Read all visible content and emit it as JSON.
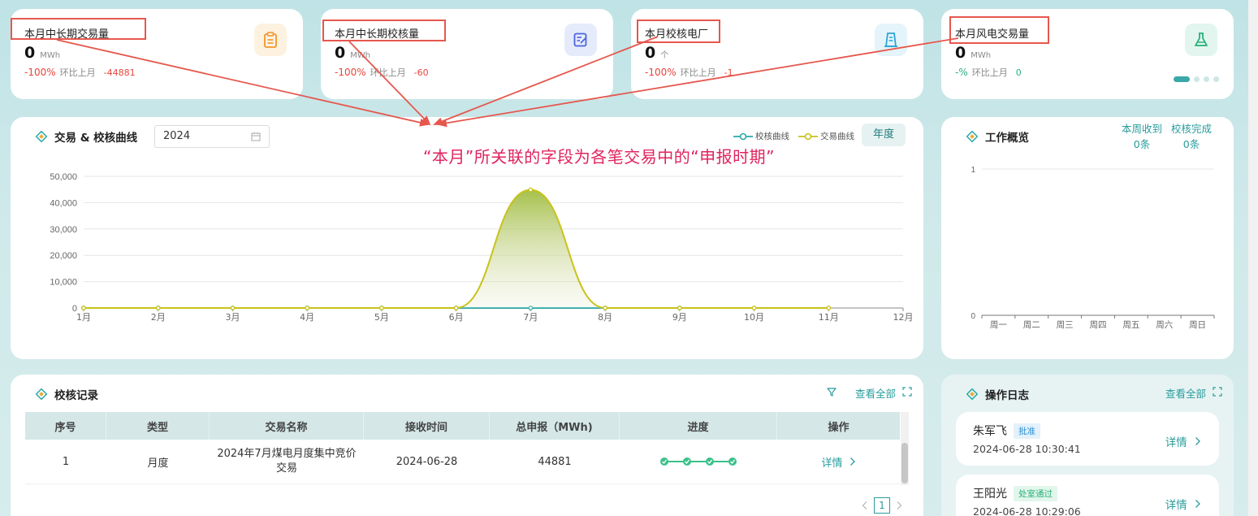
{
  "stats": [
    {
      "title": "本月中长期交易量",
      "value": "0",
      "unit": "MWh",
      "pct": "-100%",
      "ring": "环比上月",
      "delta": "-44881"
    },
    {
      "title": "本月中长期校核量",
      "value": "0",
      "unit": "MWh",
      "pct": "-100%",
      "ring": "环比上月",
      "delta": "-60"
    },
    {
      "title": "本月校核电厂",
      "value": "0",
      "unit": "个",
      "pct": "-100%",
      "ring": "环比上月",
      "delta": "-1"
    },
    {
      "title": "本月风电交易量",
      "value": "0",
      "unit": "MWh",
      "pct": "-%",
      "ring": "环比上月",
      "delta": "0"
    }
  ],
  "icons": {
    "stat1": "clipboard-icon",
    "stat2": "edit-doc-icon",
    "stat3": "building-icon",
    "stat4": "flask-icon"
  },
  "colors": {
    "accent": "#2a9c9c",
    "negative": "#e8453c",
    "positive": "#2ab07b",
    "annotation": "#e0245e",
    "highlight": "#e6574d",
    "series_check": "#2aa9a9",
    "series_trade": "#c9c21a"
  },
  "annotation": "“本月”所关联的字段为各笔交易中的“申报时期”",
  "curve_panel": {
    "title": "交易 & 校核曲线",
    "year": "2024",
    "year_button": "年度"
  },
  "chart_data": [
    {
      "type": "area",
      "title": "交易 & 校核曲线",
      "categories": [
        "1月",
        "2月",
        "3月",
        "4月",
        "5月",
        "6月",
        "7月",
        "8月",
        "9月",
        "10月",
        "11月",
        "12月"
      ],
      "y_ticks": [
        "0",
        "10,000",
        "20,000",
        "30,000",
        "40,000",
        "50,000"
      ],
      "ylim": [
        0,
        50000
      ],
      "grid": true,
      "legend_position": "top-right",
      "series": [
        {
          "name": "校核曲线",
          "values": [
            0,
            0,
            0,
            0,
            0,
            0,
            0,
            0,
            0,
            null,
            null,
            null
          ]
        },
        {
          "name": "交易曲线",
          "values": [
            0,
            0,
            0,
            0,
            0,
            0,
            44881,
            0,
            0,
            0,
            0,
            null
          ]
        }
      ]
    },
    {
      "type": "bar",
      "title": "工作概览",
      "categories": [
        "周一",
        "周二",
        "周三",
        "周四",
        "周五",
        "周六",
        "周日"
      ],
      "y_ticks": [
        "0",
        "1"
      ],
      "ylim": [
        0,
        1
      ],
      "series": [
        {
          "name": "本周收到",
          "values": [
            0,
            0,
            0,
            0,
            0,
            0,
            0
          ]
        },
        {
          "name": "校核完成",
          "values": [
            0,
            0,
            0,
            0,
            0,
            0,
            0
          ]
        }
      ]
    }
  ],
  "overview": {
    "title": "工作概览",
    "received_label": "本周收到",
    "received_value": "0条",
    "checked_label": "校核完成",
    "checked_value": "0条"
  },
  "records": {
    "title": "校核记录",
    "view_all": "查看全部",
    "columns": [
      "序号",
      "类型",
      "交易名称",
      "接收时间",
      "总申报（MWh)",
      "进度",
      "操作"
    ],
    "rows": [
      {
        "no": "1",
        "type": "月度",
        "name": "2024年7月煤电月度集中竞价交易",
        "time": "2024-06-28",
        "total": "44881",
        "steps": 4,
        "action": "详情"
      }
    ],
    "page": "1"
  },
  "logs": {
    "title": "操作日志",
    "view_all": "查看全部",
    "items": [
      {
        "name": "朱军飞",
        "badge": "批准",
        "time": "2024-06-28 10:30:41",
        "detail": "详情"
      },
      {
        "name": "王阳光",
        "badge": "处室通过",
        "time": "2024-06-28 10:29:06",
        "detail": "详情"
      }
    ]
  }
}
